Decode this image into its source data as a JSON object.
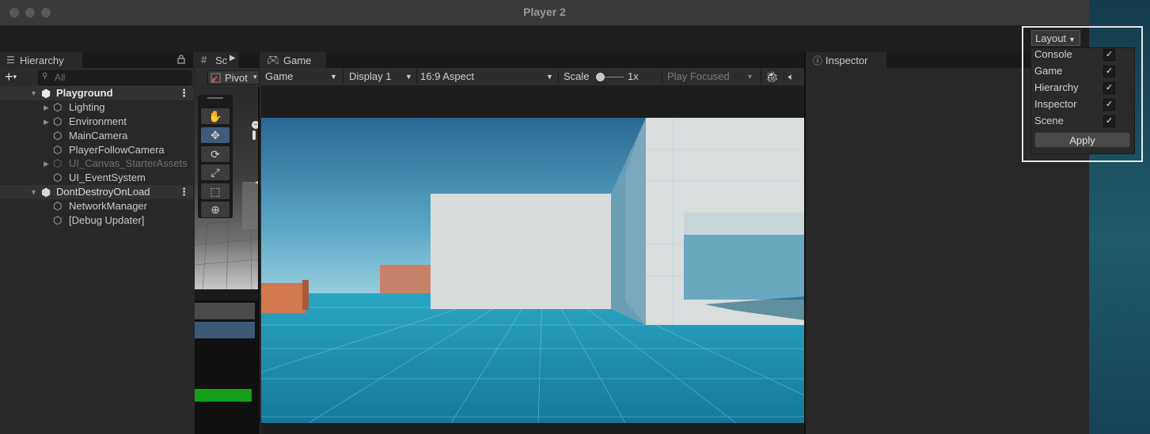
{
  "window": {
    "title": "Player 2"
  },
  "hierarchy": {
    "tab_label": "Hierarchy",
    "search_placeholder": "All",
    "add_label": "+",
    "rows": [
      {
        "label": "Playground"
      },
      {
        "label": "Lighting"
      },
      {
        "label": "Environment"
      },
      {
        "label": "MainCamera"
      },
      {
        "label": "PlayerFollowCamera"
      },
      {
        "label": "UI_Canvas_StarterAssets"
      },
      {
        "label": "UI_EventSystem"
      },
      {
        "label": "DontDestroyOnLoad"
      },
      {
        "label": "NetworkManager"
      },
      {
        "label": "[Debug Updater]"
      }
    ]
  },
  "scene": {
    "tab_label": "Sc",
    "pivot_label": "Pivot"
  },
  "game": {
    "tab_label": "Game",
    "mode_label": "Game",
    "display_label": "Display 1",
    "aspect_label": "16:9 Aspect",
    "scale_label": "Scale",
    "scale_value": "1x",
    "play_mode_label": "Play Focused"
  },
  "inspector": {
    "tab_label": "Inspector"
  },
  "layout": {
    "button_label": "Layout",
    "items": [
      {
        "label": "Console",
        "checked": true
      },
      {
        "label": "Game",
        "checked": true
      },
      {
        "label": "Hierarchy",
        "checked": true
      },
      {
        "label": "Inspector",
        "checked": true
      },
      {
        "label": "Scene",
        "checked": true
      }
    ],
    "apply_label": "Apply",
    "check_glyph": "✓"
  },
  "colors": {
    "sky_top": "#2a6e9a",
    "floor": "#1f8fb0",
    "accent_selected": "#3e5c7a",
    "green_bar": "#16a018"
  }
}
